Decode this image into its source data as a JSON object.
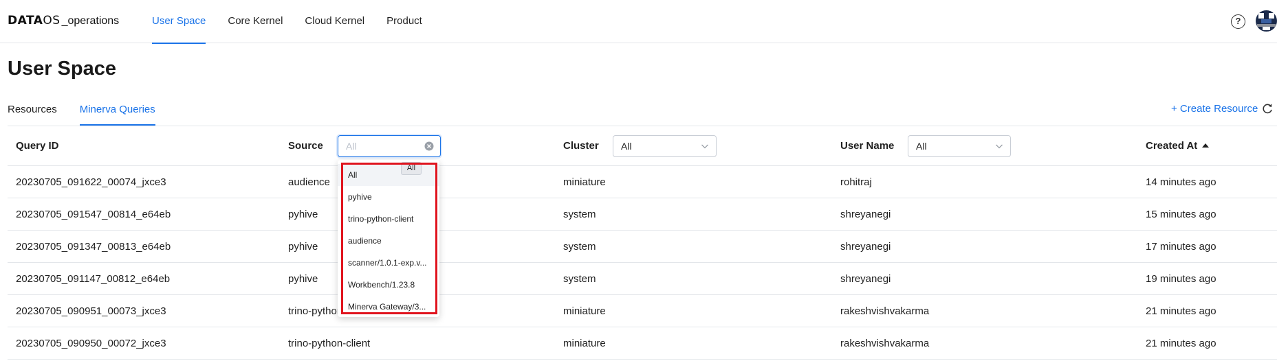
{
  "app": {
    "brand_bold": "DATA",
    "brand_thin": "OS",
    "context": "_operations"
  },
  "nav": {
    "tabs": [
      "User Space",
      "Core Kernel",
      "Cloud Kernel",
      "Product"
    ],
    "active": "User Space"
  },
  "help": "?",
  "page": {
    "title": "User Space"
  },
  "subtabs": {
    "items": [
      "Resources",
      "Minerva Queries"
    ],
    "active": "Minerva Queries"
  },
  "actions": {
    "create_resource": "+ Create Resource"
  },
  "table": {
    "columns": {
      "query_id": "Query ID",
      "source": "Source",
      "cluster": "Cluster",
      "user_name": "User Name",
      "created_at": "Created At"
    },
    "filters": {
      "source_placeholder": "All",
      "cluster_value": "All",
      "user_name_value": "All"
    },
    "rows": [
      {
        "query_id": "20230705_091622_00074_jxce3",
        "source": "audience",
        "cluster": "miniature",
        "user": "rohitraj",
        "created": "14 minutes ago"
      },
      {
        "query_id": "20230705_091547_00814_e64eb",
        "source": "pyhive",
        "cluster": "system",
        "user": "shreyanegi",
        "created": "15 minutes ago"
      },
      {
        "query_id": "20230705_091347_00813_e64eb",
        "source": "pyhive",
        "cluster": "system",
        "user": "shreyanegi",
        "created": "17 minutes ago"
      },
      {
        "query_id": "20230705_091147_00812_e64eb",
        "source": "pyhive",
        "cluster": "system",
        "user": "shreyanegi",
        "created": "19 minutes ago"
      },
      {
        "query_id": "20230705_090951_00073_jxce3",
        "source": "trino-python-client",
        "cluster": "miniature",
        "user": "rakeshvishvakarma",
        "created": "21 minutes ago"
      },
      {
        "query_id": "20230705_090950_00072_jxce3",
        "source": "trino-python-client",
        "cluster": "miniature",
        "user": "rakeshvishvakarma",
        "created": "21 minutes ago"
      }
    ]
  },
  "source_dropdown": {
    "options": [
      "All",
      "pyhive",
      "trino-python-client",
      "audience",
      "scanner/1.0.1-exp.v...",
      "Workbench/1.23.8",
      "Minerva Gateway/3..."
    ],
    "selected": "All",
    "tooltip": "All"
  },
  "colors": {
    "accent": "#1a73e8",
    "highlight": "#e0141e"
  }
}
